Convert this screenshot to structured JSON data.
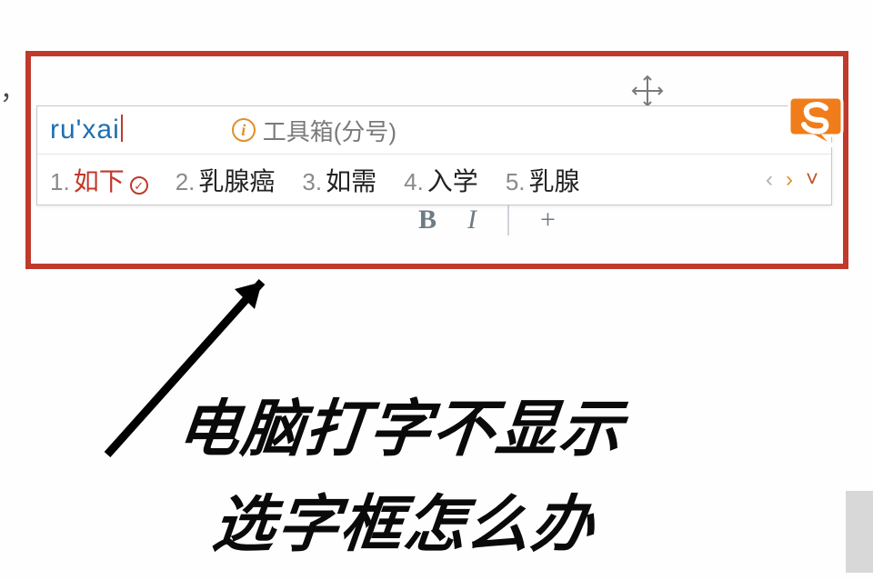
{
  "background": {
    "hint_char": "，"
  },
  "ime": {
    "input": "ru'xai",
    "toolbox_label": "工具箱(分号)",
    "candidates": [
      {
        "num": "1.",
        "text": "如下",
        "checked": true
      },
      {
        "num": "2.",
        "text": "乳腺癌"
      },
      {
        "num": "3.",
        "text": "如需"
      },
      {
        "num": "4.",
        "text": "入学"
      },
      {
        "num": "5.",
        "text": "乳腺"
      }
    ],
    "nav": {
      "prev": "‹",
      "next": "›",
      "down": "˅"
    }
  },
  "format_bar": {
    "bold": "B",
    "italic": "I",
    "add": "+"
  },
  "caption": {
    "line1": "电脑打字不显示",
    "line2": "选字框怎么办"
  }
}
